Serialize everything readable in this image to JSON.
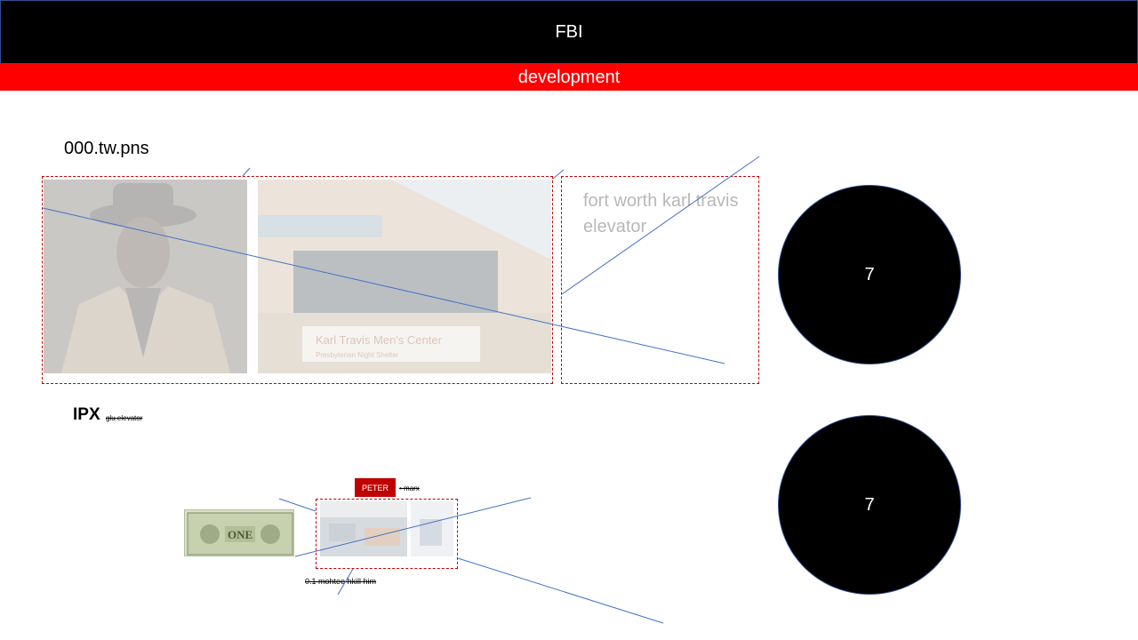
{
  "header": {
    "title": "FBI"
  },
  "subheader": {
    "label": "development"
  },
  "section1": {
    "label": "000.tw.pns",
    "caption": "fort worth karl travis elevator",
    "sign_text_line1": "Karl Travis Men's Center",
    "sign_text_line2": "Presbyterian Night Shelter"
  },
  "circles": {
    "top": "7",
    "bottom": "7"
  },
  "section2": {
    "label": "IPX",
    "note": "glu.elevator",
    "tag": "PETER",
    "tag_note": "marx",
    "caption": "0.1 mohtee hkill him",
    "banknote_text": "ONE"
  },
  "colors": {
    "header_bg": "#000000",
    "subheader_bg": "#ff0000",
    "frame": "#c00000",
    "line": "#4472c4"
  }
}
